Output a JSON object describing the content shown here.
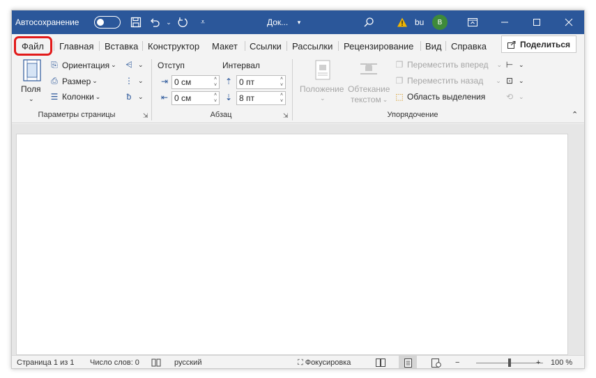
{
  "titlebar": {
    "autosave_label": "Автосохранение",
    "doc_title": "Док...",
    "user_name": "bu",
    "avatar_initial": "B",
    "colors": {
      "titlebar_bg": "#2b579a",
      "avatar_bg": "#3e8a3a",
      "warning": "#f2b600"
    }
  },
  "tabs": [
    {
      "label": "Файл"
    },
    {
      "label": "Главная"
    },
    {
      "label": "Вставка"
    },
    {
      "label": "Конструктор"
    },
    {
      "label": "Макет",
      "active": true
    },
    {
      "label": "Ссылки"
    },
    {
      "label": "Рассылки"
    },
    {
      "label": "Рецензирование"
    },
    {
      "label": "Вид"
    },
    {
      "label": "Справка"
    }
  ],
  "share_label": "Поделиться",
  "ribbon": {
    "page_setup": {
      "margins_label": "Поля",
      "orientation_label": "Ориентация",
      "size_label": "Размер",
      "columns_label": "Колонки",
      "group_label": "Параметры страницы"
    },
    "paragraph": {
      "indent_label": "Отступ",
      "spacing_label": "Интервал",
      "indent_left": "0 см",
      "indent_right": "0 см",
      "spacing_before": "0 пт",
      "spacing_after": "8 пт",
      "group_label": "Абзац"
    },
    "arrange": {
      "position_label": "Положение",
      "wrap_label_1": "Обтекание",
      "wrap_label_2": "текстом",
      "bring_forward_label": "Переместить вперед",
      "send_backward_label": "Переместить назад",
      "selection_pane_label": "Область выделения",
      "group_label": "Упорядочение"
    }
  },
  "statusbar": {
    "page_info": "Страница 1 из 1",
    "word_count": "Число слов: 0",
    "language": "русский",
    "focus_label": "Фокусировка",
    "zoom_minus": "−",
    "zoom_plus": "+",
    "zoom_level": "100 %",
    "zoom_fraction": 0.5
  }
}
